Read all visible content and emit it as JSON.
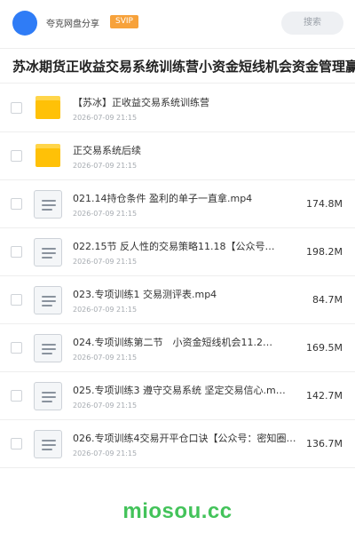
{
  "header": {
    "share_name": "夸克网盘分享",
    "badge": "SVIP",
    "search_label": "搜索"
  },
  "title": "苏冰期货正收益交易系统训练营小资金短线机会资金管理赢",
  "files": [
    {
      "name": "【苏冰】正收益交易系统训练营",
      "date": "2026-07-09 21:15",
      "size": "",
      "type": "folder"
    },
    {
      "name": "正交易系统后续",
      "date": "2026-07-09 21:15",
      "size": "",
      "type": "folder"
    },
    {
      "name": "021.14持仓条件 盈利的单子一直拿.mp4",
      "date": "2026-07-09 21:15",
      "size": "174.8M",
      "type": "file"
    },
    {
      "name": "022.15节 反人性的交易策略11.18【公众号…",
      "date": "2026-07-09 21:15",
      "size": "198.2M",
      "type": "file"
    },
    {
      "name": "023.专项训练1 交易测评表.mp4",
      "date": "2026-07-09 21:15",
      "size": "84.7M",
      "type": "file"
    },
    {
      "name": "024.专项训练第二节　小资金短线机会11.2…",
      "date": "2026-07-09 21:15",
      "size": "169.5M",
      "type": "file"
    },
    {
      "name": "025.专项训练3 遵守交易系统 坚定交易信心.m…",
      "date": "2026-07-09 21:15",
      "size": "142.7M",
      "type": "file"
    },
    {
      "name": "026.专项训练4交易开平仓口诀【公众号：密知圈】…",
      "date": "2026-07-09 21:15",
      "size": "136.7M",
      "type": "file"
    }
  ],
  "watermark": "miosou.cc",
  "colors": {
    "accent": "#2f7cf6",
    "svip": "#f7a23b",
    "folder": "#ffc107",
    "watermark": "#43c35a"
  }
}
